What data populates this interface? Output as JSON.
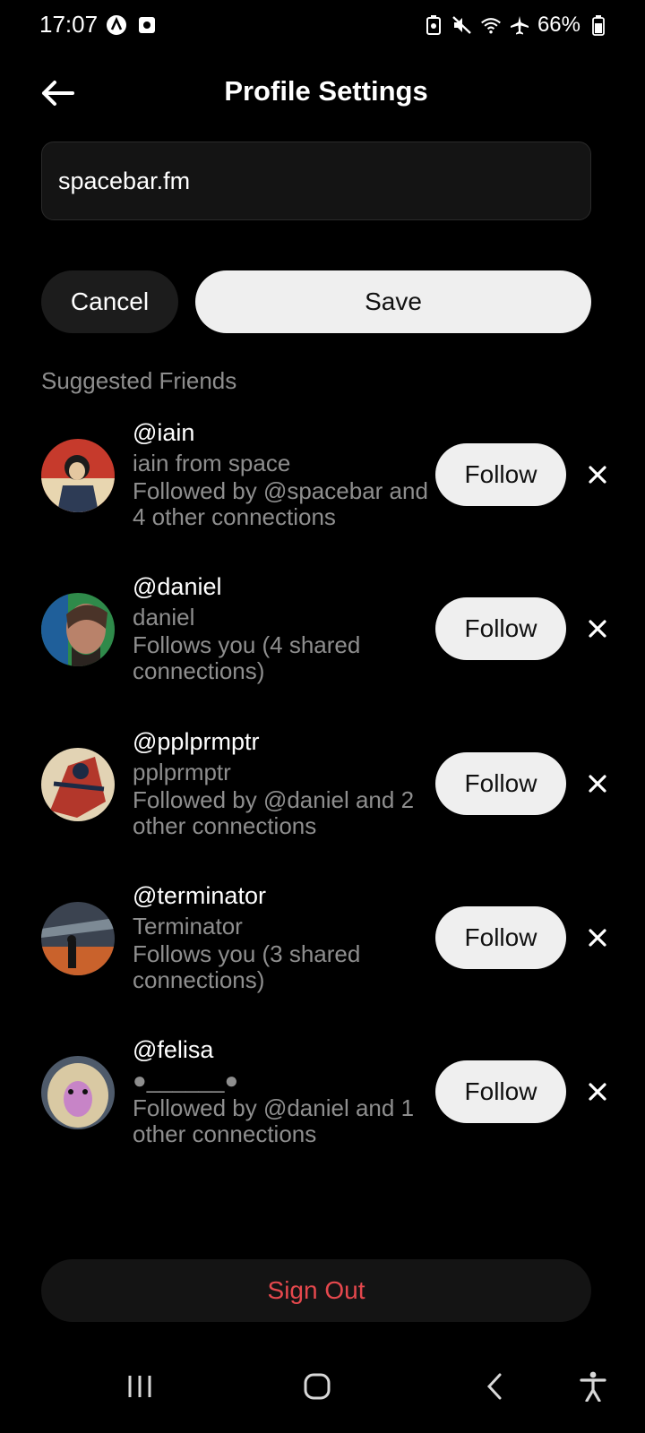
{
  "status_bar": {
    "time": "17:07",
    "battery": "66%",
    "icons_left": [
      "notification-a-icon",
      "notification-square-icon"
    ],
    "icons_right": [
      "battery-saver-icon",
      "mute-icon",
      "wifi-icon",
      "airplane-icon",
      "battery-icon"
    ]
  },
  "header": {
    "title": "Profile Settings",
    "back_icon": "back-arrow-icon"
  },
  "website_field": {
    "value": "spacebar.fm"
  },
  "actions": {
    "cancel_label": "Cancel",
    "save_label": "Save"
  },
  "suggested": {
    "title": "Suggested Friends",
    "follow_label": "Follow",
    "friends": [
      {
        "handle": "@iain",
        "name": "iain from space",
        "note": "Followed by @spacebar and 4 other connections"
      },
      {
        "handle": "@daniel",
        "name": "daniel",
        "note": "Follows you (4 shared connections)"
      },
      {
        "handle": "@pplprmptr",
        "name": "pplprmptr",
        "note": "Followed by @daniel and 2 other connections"
      },
      {
        "handle": "@terminator",
        "name": "Terminator",
        "note": "Follows you (3 shared connections)"
      },
      {
        "handle": "@felisa",
        "name": "●______●",
        "note": "Followed by @daniel and 1 other connections"
      }
    ]
  },
  "sign_out": {
    "label": "Sign Out",
    "color": "#e5484d"
  },
  "nav_bar": {
    "icons": [
      "recents-icon",
      "home-icon",
      "back-icon",
      "accessibility-icon"
    ]
  },
  "colors": {
    "background": "#000000",
    "surface": "#141414",
    "button_light": "#efefef",
    "muted_text": "#8e8e8e"
  }
}
